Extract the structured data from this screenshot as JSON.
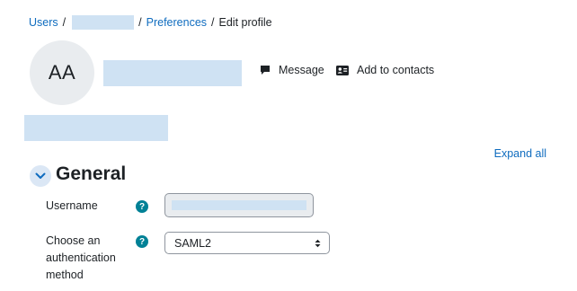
{
  "breadcrumb": {
    "users": "Users",
    "separator": "/",
    "preferences": "Preferences",
    "current": "Edit profile"
  },
  "profile": {
    "initials": "AA",
    "message_label": "Message",
    "add_contacts_label": "Add to contacts"
  },
  "expand_all_label": "Expand all",
  "section": {
    "title": "General",
    "toggle_icon": "chevron-down-icon"
  },
  "form": {
    "username_label": "Username",
    "auth_label": "Choose an authentication method",
    "auth_value": "SAML2",
    "help_glyph": "?"
  },
  "colors": {
    "link": "#0f6cbf",
    "help_icon": "#008196",
    "redaction": "#cfe2f3",
    "avatar_bg": "#e9ecef"
  },
  "icons": [
    "speech-bubble-icon",
    "address-card-icon",
    "chevron-down-icon",
    "help-icon",
    "select-arrows-icon"
  ]
}
